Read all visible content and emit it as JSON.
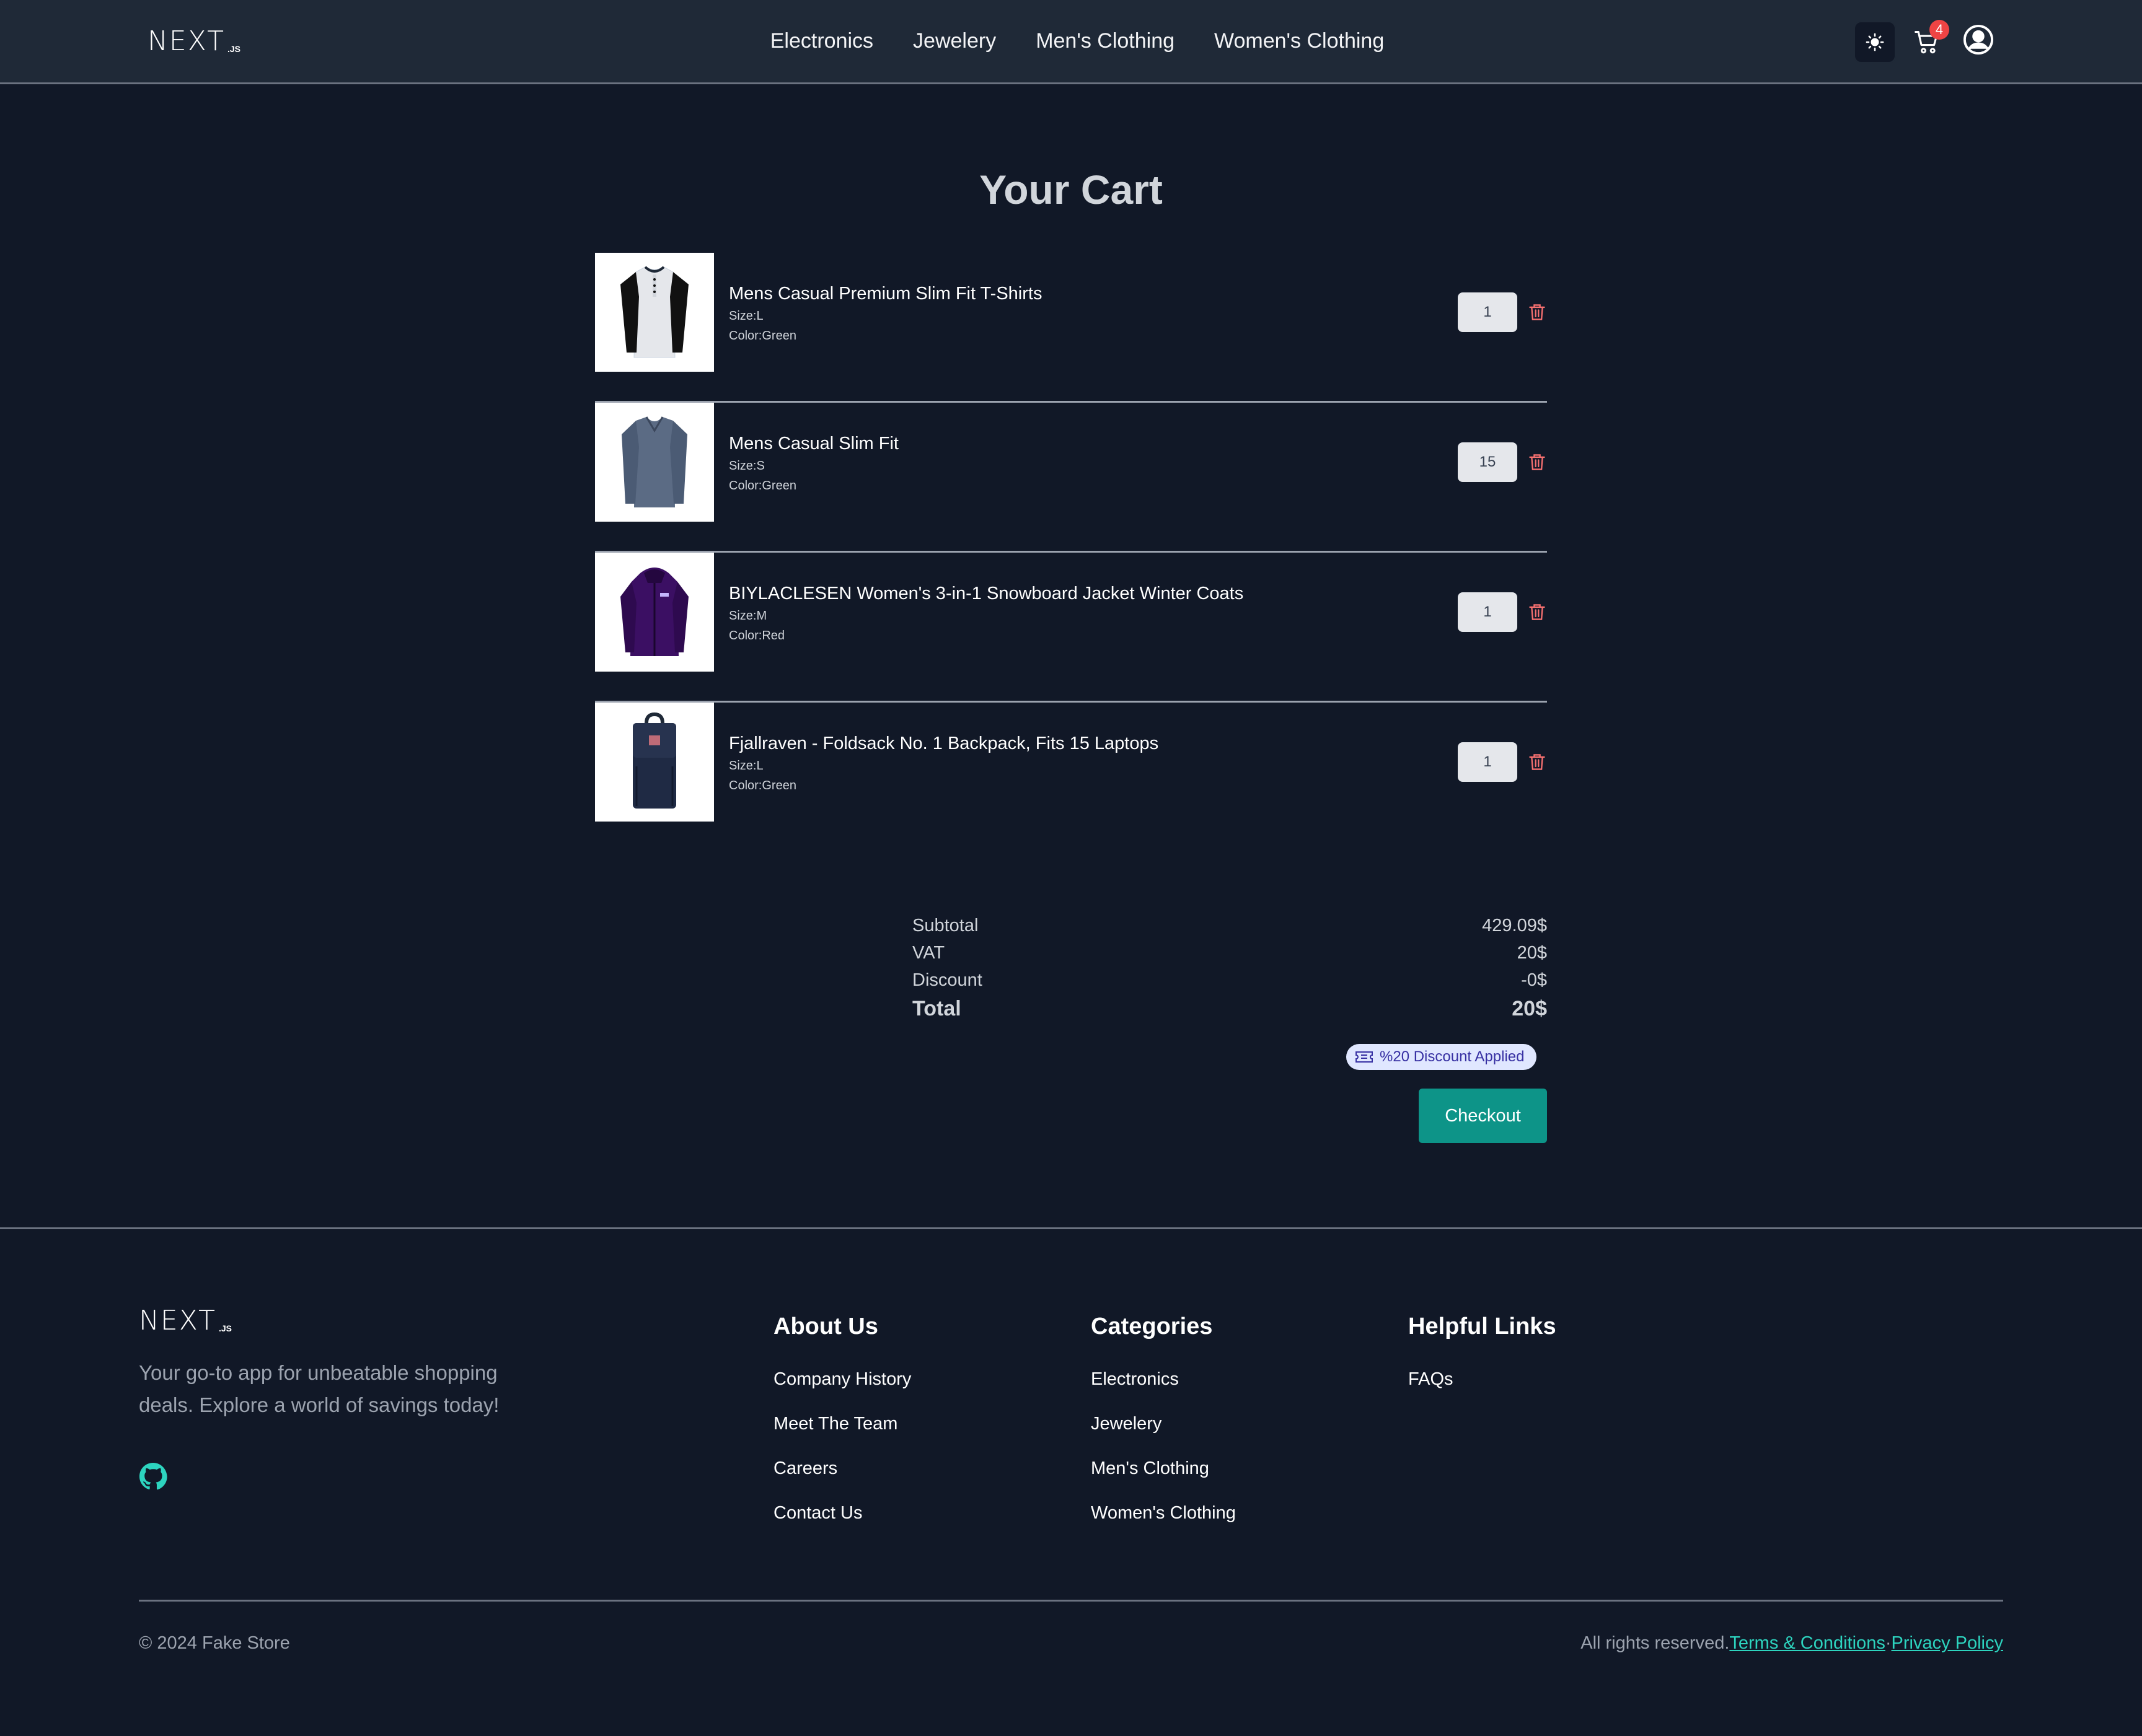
{
  "header": {
    "logo_main": "NEXT",
    "logo_sub": ".JS",
    "nav": [
      {
        "label": "Electronics"
      },
      {
        "label": "Jewelery"
      },
      {
        "label": "Men's Clothing"
      },
      {
        "label": "Women's Clothing"
      }
    ],
    "theme_icon": "sun-icon",
    "cart_icon": "cart-icon",
    "cart_count": "4",
    "user_icon": "user-circle-icon"
  },
  "cart": {
    "title": "Your Cart",
    "items": [
      {
        "name": "Mens Casual Premium Slim Fit T-Shirts",
        "size": "Size:L",
        "color": "Color:Green",
        "qty": "1",
        "image": "raglan-tshirt-product-image"
      },
      {
        "name": "Mens Casual Slim Fit",
        "size": "Size:S",
        "color": "Color:Green",
        "qty": "15",
        "image": "long-sleeve-shirt-product-image"
      },
      {
        "name": "BIYLACLESEN Women's 3-in-1 Snowboard Jacket Winter Coats",
        "size": "Size:M",
        "color": "Color:Red",
        "qty": "1",
        "image": "purple-jacket-product-image"
      },
      {
        "name": "Fjallraven - Foldsack No. 1 Backpack, Fits 15 Laptops",
        "size": "Size:L",
        "color": "Color:Green",
        "qty": "1",
        "image": "backpack-product-image"
      }
    ]
  },
  "summary": {
    "subtotal_label": "Subtotal",
    "subtotal_value": "429.09$",
    "vat_label": "VAT",
    "vat_value": "20$",
    "discount_label": "Discount",
    "discount_value": "-0$",
    "total_label": "Total",
    "total_value": "20$",
    "discount_badge": "%20 Discount Applied",
    "checkout_label": "Checkout"
  },
  "footer": {
    "logo_main": "NEXT",
    "logo_sub": ".JS",
    "tagline": "Your go-to app for unbeatable shopping deals. Explore a world of savings today!",
    "github_icon": "github-icon",
    "about": {
      "title": "About Us",
      "links": [
        "Company History",
        "Meet The Team",
        "Careers",
        "Contact Us"
      ]
    },
    "categories": {
      "title": "Categories",
      "links": [
        "Electronics",
        "Jewelery",
        "Men's Clothing",
        "Women's Clothing"
      ]
    },
    "helpful": {
      "title": "Helpful Links",
      "links": [
        "FAQs"
      ]
    },
    "copyright": "© 2024 Fake Store",
    "rights": "All rights reserved.",
    "terms": "Terms & Conditions",
    "separator": "·",
    "privacy": "Privacy Policy"
  },
  "colors": {
    "background": "#111827",
    "header_bg": "#1f2937",
    "accent": "#0d9488",
    "link_accent": "#2dd4bf",
    "badge": "#ef4444"
  }
}
